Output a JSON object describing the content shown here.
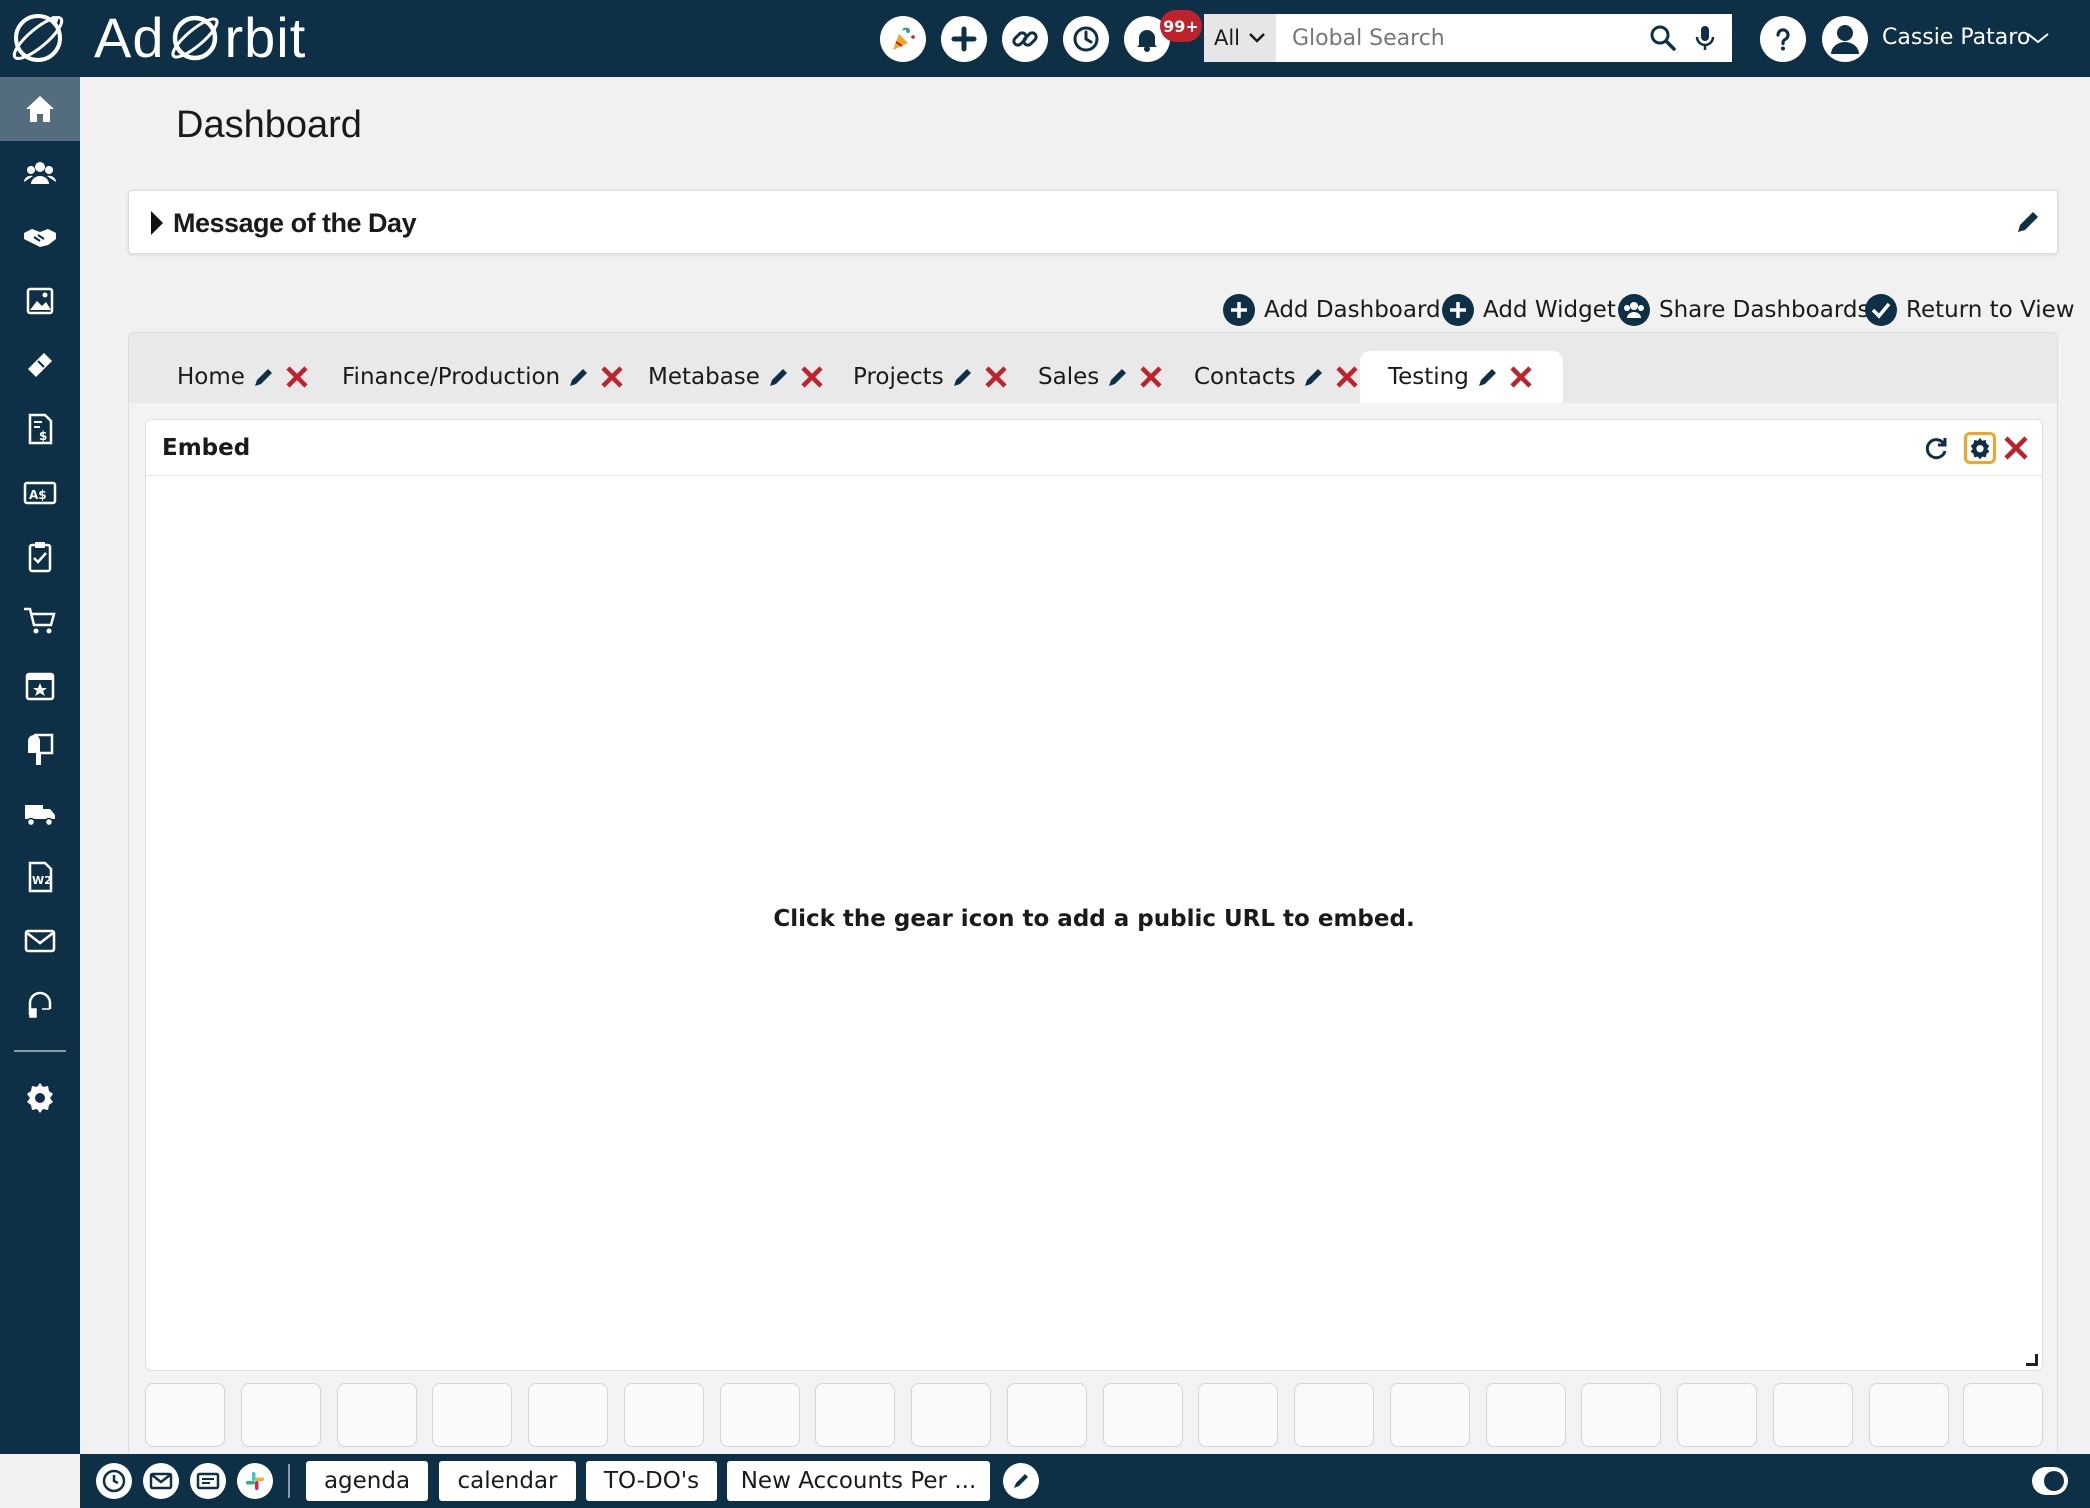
{
  "app": {
    "brand": "Ad",
    "brand_suffix": "rbit"
  },
  "topbar": {
    "notifications_badge": "99+",
    "search": {
      "scope": "All",
      "placeholder": "Global Search"
    },
    "user": {
      "name": "Cassie Pataro"
    },
    "icons": [
      "party-icon",
      "plus-icon",
      "link-icon",
      "history-icon",
      "bell-icon",
      "search-icon",
      "microphone-icon",
      "help-icon",
      "user-avatar-icon",
      "chevron-down-icon"
    ]
  },
  "sidebar": {
    "items": [
      "home-icon",
      "contacts-icon",
      "handshake-icon",
      "media-icon",
      "ticket-icon",
      "invoice-icon",
      "billing-icon",
      "clipboard-icon",
      "cart-icon",
      "calendar-star-icon",
      "mailbox-icon",
      "truck-icon",
      "w2-icon",
      "mail-icon",
      "support-icon",
      "settings-icon"
    ],
    "active": "home-icon"
  },
  "page": {
    "title": "Dashboard",
    "message_of_the_day": "Message of the Day"
  },
  "actions": {
    "add_dashboard": "Add Dashboard",
    "add_widget": "Add Widget",
    "share_dashboards": "Share Dashboards",
    "return_to_view": "Return to View"
  },
  "tabs": [
    {
      "label": "Home"
    },
    {
      "label": "Finance/Production"
    },
    {
      "label": "Metabase"
    },
    {
      "label": "Projects"
    },
    {
      "label": "Sales"
    },
    {
      "label": "Contacts"
    },
    {
      "label": "Testing",
      "active": true
    }
  ],
  "widget": {
    "title": "Embed",
    "message": "Click the gear icon to add a public URL to embed."
  },
  "bottombar": {
    "chips": [
      "agenda",
      "calendar",
      "TO-DO's",
      "New Accounts Per ..."
    ],
    "icons": [
      "clock-icon",
      "mail-icon",
      "email-icon",
      "slack-icon",
      "edit-icon",
      "toggle-icon"
    ]
  },
  "colors": {
    "navy": "#0e3047",
    "active_nav": "#546d7e",
    "close_red": "#c0222b",
    "focus_outline": "#f3a623",
    "badge_red": "#c0222b"
  }
}
